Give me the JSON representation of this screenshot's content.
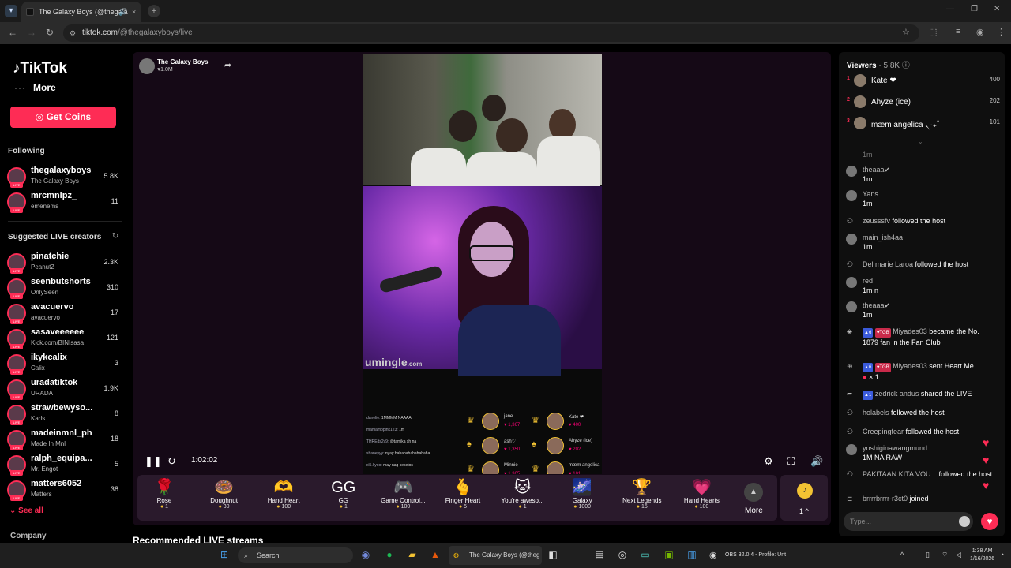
{
  "browser": {
    "tab_title": "The Galaxy Boys (@thegala",
    "tab_close": "×",
    "url_host": "tiktok.com",
    "url_path": "/@thegalaxyboys/live",
    "window_controls": [
      "—",
      "❐",
      "✕"
    ]
  },
  "sidebar": {
    "logo": "TikTok",
    "more": "More",
    "coins_button": "Get Coins",
    "following_header": "Following",
    "following": [
      {
        "name": "thegalaxyboys",
        "sub": "The Galaxy Boys",
        "count": "5.8K"
      },
      {
        "name": "mrcmnlpz_",
        "sub": "emenems",
        "count": "11"
      }
    ],
    "suggested_header": "Suggested LIVE creators",
    "suggested": [
      {
        "name": "pinatchie",
        "sub": "PeanutZ",
        "count": "2.3K"
      },
      {
        "name": "seenbutshorts",
        "sub": "OnlySeen",
        "count": "310"
      },
      {
        "name": "avacuervo",
        "sub": "avacuervo",
        "count": "17"
      },
      {
        "name": "sasaveeeeee",
        "sub": "Kick.com/BINIsasa",
        "count": "121"
      },
      {
        "name": "ikykcalix",
        "sub": "Calix",
        "count": "3"
      },
      {
        "name": "uradatiktok",
        "sub": "URADA",
        "count": "1.9K"
      },
      {
        "name": "strawbewyso...",
        "sub": "Karls",
        "count": "8"
      },
      {
        "name": "madeinmnl_ph",
        "sub": "Made In Mnl",
        "count": "18"
      },
      {
        "name": "ralph_equipa...",
        "sub": "Mr. Engot",
        "count": "5"
      },
      {
        "name": "matters6052",
        "sub": "Matters",
        "count": "38"
      }
    ],
    "see_all": "See all",
    "company": "Company",
    "live_badge": "LIVE"
  },
  "stream": {
    "host_name": "The Galaxy Boys",
    "host_likes": "♥1.0M",
    "elapsed": "1:02:02",
    "watermark": "umingle",
    "watermark_suffix": ".com",
    "overlay_chat": [
      {
        "user": "danelie:",
        "text": "1MMMM NAAAA"
      },
      {
        "user": "mamamopink123:",
        "text": "1m"
      },
      {
        "user": "THREds2v9:",
        "text": "@tamika sh na"
      },
      {
        "user": "shaneyyy:",
        "text": "nyay hahahahahahahaha"
      },
      {
        "user": "xl5.kyoo:",
        "text": "may nag sesetos"
      }
    ],
    "overlay_gifters": [
      {
        "name": "jane",
        "count": "♥ 1,367"
      },
      {
        "name": "ash♡",
        "count": "♥ 1,350"
      },
      {
        "name": "Minnie",
        "count": "♥ 1,305"
      },
      {
        "name": "Kate ❤",
        "count": "♥ 400"
      },
      {
        "name": "Ahyze (ice)",
        "count": "♥ 202"
      },
      {
        "name": "mæm angelica",
        "count": "♥ 101"
      }
    ]
  },
  "gifts": [
    {
      "name": "Rose",
      "price": "1",
      "icon": "🌹"
    },
    {
      "name": "Doughnut",
      "price": "30",
      "icon": "🍩"
    },
    {
      "name": "Hand Heart",
      "price": "100",
      "icon": "🫶"
    },
    {
      "name": "GG",
      "price": "1",
      "icon": "GG"
    },
    {
      "name": "Game Control...",
      "price": "100",
      "icon": "🎮"
    },
    {
      "name": "Finger Heart",
      "price": "5",
      "icon": "🫰"
    },
    {
      "name": "You're aweso...",
      "price": "1",
      "icon": "🐱"
    },
    {
      "name": "Galaxy",
      "price": "1000",
      "icon": "🌌"
    },
    {
      "name": "Next Legends",
      "price": "15",
      "icon": "🏆"
    },
    {
      "name": "Hand Hearts",
      "price": "100",
      "icon": "💗"
    }
  ],
  "gift_more": "More",
  "coin_balance": "1",
  "recommended": "Recommended LIVE streams",
  "viewers": {
    "label": "Viewers",
    "count": "· 5.8K",
    "top": [
      {
        "rank": "1",
        "name": "Kate ❤",
        "score": "400"
      },
      {
        "rank": "2",
        "name": "Ahyze (ice)",
        "score": "202"
      },
      {
        "rank": "3",
        "name": "mæm angelica ৲·₊˚",
        "score": "101"
      }
    ]
  },
  "chat": [
    {
      "type": "msg",
      "user": "theaaa✔",
      "text": "1m"
    },
    {
      "type": "msg",
      "user": "Yans.",
      "text": "1m"
    },
    {
      "type": "event",
      "user": "zeusssfv",
      "text": "followed the host"
    },
    {
      "type": "msg",
      "user": "main_ish4aa",
      "text": "1m"
    },
    {
      "type": "event",
      "user": "Del marie Laroa",
      "text": "followed the host"
    },
    {
      "type": "msg",
      "user": "red",
      "text": "1m n"
    },
    {
      "type": "msg",
      "user": "theaaa✔",
      "text": "1m"
    },
    {
      "type": "event",
      "user": "Miyades03",
      "text": "became the No. 1879 fan in the Fan Club"
    },
    {
      "type": "event",
      "user": "Miyades03",
      "text": "sent Heart Me"
    },
    {
      "type": "event",
      "user": "zedrick andus",
      "text": "shared the LIVE"
    },
    {
      "type": "event",
      "user": "holabels",
      "text": "followed the host"
    },
    {
      "type": "event",
      "user": "Creepingfear",
      "text": "followed the host"
    },
    {
      "type": "msg",
      "user": "yoshiginawangmund...",
      "text": "1M NA RAW"
    },
    {
      "type": "event",
      "user": "PAKITAAN KITA VOU...",
      "text": "followed the host"
    },
    {
      "type": "event",
      "user": "brrrrbrrrr-r3ct0",
      "text": "joined"
    }
  ],
  "chat_extra": {
    "prev_msg": "1m",
    "fan_level": "6",
    "fan_badge": "TGB",
    "gift_count": "× 1",
    "share_level": "1"
  },
  "chat_input_placeholder": "Type...",
  "taskbar": {
    "search": "Search",
    "chrome_label": "The Galaxy Boys (@theg",
    "obs_label": "OBS 32.0.4 - Profile: Unt",
    "time": "1:38 AM",
    "date": "1/16/2026"
  },
  "colors": {
    "accent": "#fe2c55",
    "panel": "#0f0f0f",
    "stage": "#150916"
  }
}
